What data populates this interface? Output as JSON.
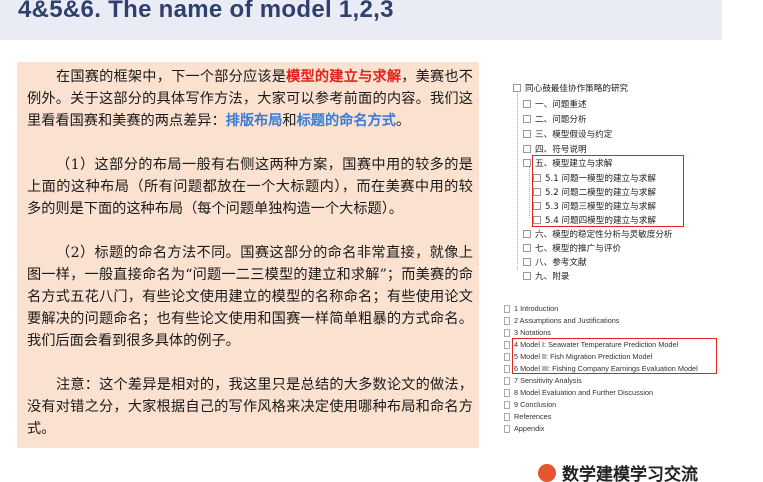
{
  "slide": {
    "title": "4&5&6. The name of model 1,2,3"
  },
  "text": {
    "p1": {
      "a": "在国赛的框架中，下一个部分应该是",
      "b": "模型的建立与求解",
      "c": "，美赛也不例外。关于这部分的具体写作方法，大家可以参考前面的内容。我们这里看看国赛和美赛的两点差异：",
      "d": "排版布局",
      "e": "和",
      "f": "标题的命名方式",
      "g": "。"
    },
    "p2": "（1）这部分的布局一般有右侧这两种方案，国赛中用的较多的是上面的这种布局（所有问题都放在一个大标题内），而在美赛中用的较多的则是下面的这种布局（每个问题单独构造一个大标题）。",
    "p3": "（2）标题的命名方法不同。国赛这部分的命名非常直接，就像上图一样，一般直接命名为“问题一二三模型的建立和求解”；而美赛的命名方式五花八门，有些论文使用建立的模型的名称命名；有些使用论文要解决的问题命名；也有些论文使用和国赛一样简单粗暴的方式命名。我们后面会看到很多具体的例子。",
    "p4": "注意：这个差异是相对的，我这里只是总结的大多数论文的做法，没有对错之分，大家根据自己的写作风格来决定使用哪种布局和命名方式。"
  },
  "toc_cn": {
    "root": "同心鼓最佳协作策略的研究",
    "items": [
      "一、问题重述",
      "二、问题分析",
      "三、模型假设与约定",
      "四、符号说明",
      "五、模型建立与求解",
      "5.1  问题一模型的建立与求解",
      "5.2  问题二模型的建立与求解",
      "5.3  问题三模型的建立与求解",
      "5.4  问题四模型的建立与求解",
      "六、模型的稳定性分析与灵敏度分析",
      "七、模型的推广与评价",
      "八、参考文献",
      "九、附录"
    ]
  },
  "toc_en": {
    "items": [
      "1 Introduction",
      "2 Assumptions and Justifications",
      "3 Notations",
      "4 Model I: Seawater Temperature Prediction Model",
      "5 Model II: Fish Migration Prediction Model",
      "6 Model III: Fishing Company Earnings Evaluation Model",
      "7 Sensitivity Analysis",
      "8 Model Evaluation and Further Discussion",
      "9 Conclusion",
      "References",
      "Appendix"
    ]
  },
  "footer": {
    "logo_text": "数学建模学习交流"
  },
  "colors": {
    "accent_red": "#e0241c",
    "accent_blue": "#3a7bd5",
    "panel_bg": "#fbe1cf",
    "title_color": "#2f3f6e"
  }
}
